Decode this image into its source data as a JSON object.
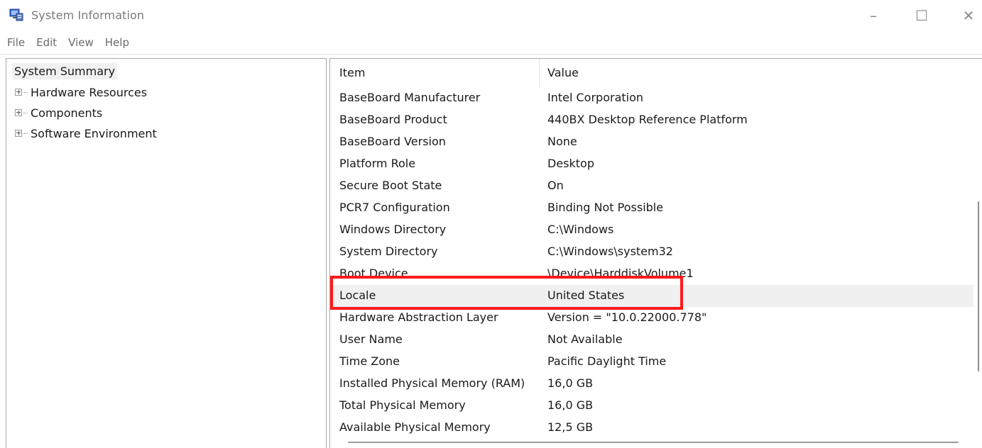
{
  "window": {
    "title": "System Information",
    "controls": {
      "minimize": "–",
      "maximize": "☐",
      "close": "✕"
    }
  },
  "menu": [
    "File",
    "Edit",
    "View",
    "Help"
  ],
  "tree": {
    "root": "System Summary",
    "children": [
      "Hardware Resources",
      "Components",
      "Software Environment"
    ]
  },
  "list": {
    "columns": {
      "item": "Item",
      "value": "Value"
    },
    "rows": [
      {
        "item": "BaseBoard Manufacturer",
        "value": "Intel Corporation"
      },
      {
        "item": "BaseBoard Product",
        "value": "440BX Desktop Reference Platform"
      },
      {
        "item": "BaseBoard Version",
        "value": "None"
      },
      {
        "item": "Platform Role",
        "value": "Desktop"
      },
      {
        "item": "Secure Boot State",
        "value": "On"
      },
      {
        "item": "PCR7 Configuration",
        "value": "Binding Not Possible"
      },
      {
        "item": "Windows Directory",
        "value": "C:\\Windows"
      },
      {
        "item": "System Directory",
        "value": "C:\\Windows\\system32"
      },
      {
        "item": "Boot Device",
        "value": "\\Device\\HarddiskVolume1"
      },
      {
        "item": "Locale",
        "value": "United States"
      },
      {
        "item": "Hardware Abstraction Layer",
        "value": "Version = \"10.0.22000.778\""
      },
      {
        "item": "User Name",
        "value": "Not Available"
      },
      {
        "item": "Time Zone",
        "value": "Pacific Daylight Time"
      },
      {
        "item": "Installed Physical Memory (RAM)",
        "value": "16,0 GB"
      },
      {
        "item": "Total Physical Memory",
        "value": "16,0 GB"
      },
      {
        "item": "Available Physical Memory",
        "value": "12,5 GB"
      }
    ],
    "selected_item": "Locale"
  },
  "colors": {
    "highlight": "#ff1a1a",
    "selection": "#f0f0f0"
  }
}
